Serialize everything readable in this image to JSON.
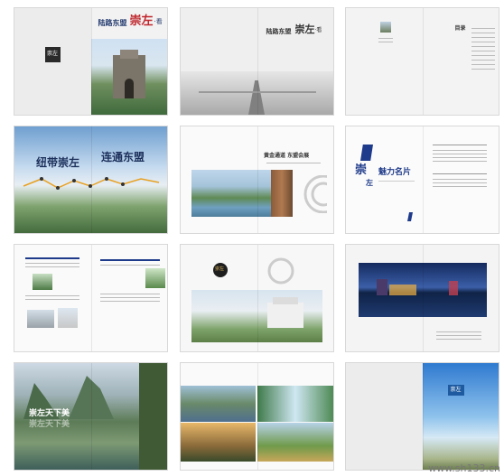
{
  "spreads": [
    {
      "id": "cover",
      "title_line": "陆路东盟",
      "title_big": "崇左",
      "title_tail": "·看",
      "badge": "崇左"
    },
    {
      "id": "cover-inner",
      "title_line": "陆路东盟",
      "title_big": "崇左",
      "title_tail": "·看"
    },
    {
      "id": "contents",
      "heading": "目录"
    },
    {
      "id": "ribbon",
      "left_title": "纽带崇左",
      "right_title": "连通东盟"
    },
    {
      "id": "gateway",
      "title": "黄金通道 东盟会展"
    },
    {
      "id": "charm",
      "big_char1": "崇",
      "big_char2": "左",
      "title": "魅力名片"
    },
    {
      "id": "text-layout"
    },
    {
      "id": "building",
      "badge": "崇左"
    },
    {
      "id": "night-city"
    },
    {
      "id": "scenery",
      "title": "崇左天下美"
    },
    {
      "id": "gallery"
    },
    {
      "id": "back-cover",
      "badge": "崇左"
    }
  ],
  "watermark": "www.sh133.cn"
}
